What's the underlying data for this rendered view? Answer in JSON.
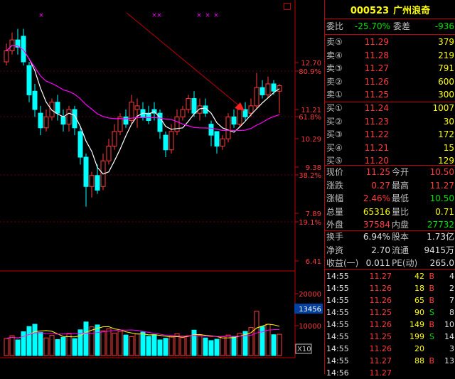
{
  "stock": {
    "code": "000523",
    "name": "广州浪奇"
  },
  "top_stats": [
    {
      "label": "委比",
      "value": "-25.70%",
      "label2": "委差",
      "value2": "-936"
    }
  ],
  "sell_orders": [
    {
      "label": "卖⑤",
      "price": "11.29",
      "volume": "379"
    },
    {
      "label": "卖④",
      "price": "11.28",
      "volume": "219"
    },
    {
      "label": "卖③",
      "price": "11.27",
      "volume": "791"
    },
    {
      "label": "卖②",
      "price": "11.26",
      "volume": "600"
    },
    {
      "label": "卖①",
      "price": "11.25",
      "volume": "300"
    }
  ],
  "buy_orders": [
    {
      "label": "买①",
      "price": "11.24",
      "volume": "1007"
    },
    {
      "label": "买②",
      "price": "11.23",
      "volume": "30"
    },
    {
      "label": "买③",
      "price": "11.22",
      "volume": "172"
    },
    {
      "label": "买④",
      "price": "11.21",
      "volume": "15"
    },
    {
      "label": "买⑤",
      "price": "11.20",
      "volume": "129"
    }
  ],
  "quote_rows": [
    {
      "l1": "现价",
      "v1": "11.25",
      "l2": "今开",
      "v2": "10.50"
    },
    {
      "l1": "涨跌",
      "v1": "0.27",
      "l2": "最高",
      "v2": "11.27"
    },
    {
      "l1": "涨幅",
      "v1": "2.46%",
      "l2": "最低",
      "v2": "10.50"
    },
    {
      "l1": "总量",
      "v1": "65316",
      "l2": "量比",
      "v2": "0.71"
    },
    {
      "l1": "外盘",
      "v1": "37584",
      "l2": "内盘",
      "v2": "27732"
    }
  ],
  "stat_rows": [
    {
      "l1": "换手",
      "v1": "6.94%",
      "l2": "股本",
      "v2": "1.73亿"
    },
    {
      "l1": "净资",
      "v1": "2.70",
      "l2": "流通",
      "v2": "9415万"
    },
    {
      "l1": "收益(一)",
      "v1": "0.011",
      "l2": "PE(动)",
      "v2": "265.0"
    }
  ],
  "trades": [
    {
      "time": "14:55",
      "price": "11.27",
      "volume": "42",
      "side": "B",
      "count": "4"
    },
    {
      "time": "14:55",
      "price": "11.26",
      "volume": "18",
      "side": "B",
      "count": "2"
    },
    {
      "time": "14:55",
      "price": "11.26",
      "volume": "65",
      "side": "B",
      "count": "7"
    },
    {
      "time": "14:55",
      "price": "11.25",
      "volume": "90",
      "side": "S",
      "count": "8"
    },
    {
      "time": "14:55",
      "price": "11.26",
      "volume": "149",
      "side": "B",
      "count": "10"
    },
    {
      "time": "14:55",
      "price": "11.25",
      "volume": "199",
      "side": "S",
      "count": "14"
    },
    {
      "time": "14:55",
      "price": "11.26",
      "volume": "20",
      "side": "",
      "count": "3"
    },
    {
      "time": "14:55",
      "price": "11.27",
      "volume": "88",
      "side": "B",
      "count": "13"
    },
    {
      "time": "14:56",
      "price": "11.27",
      "volume": "",
      "side": "",
      "count": ""
    }
  ],
  "price_axis": [
    {
      "label": "12.70"
    },
    {
      "label": "80.9%"
    },
    {
      "label": "11.21"
    },
    {
      "label": "61.8%"
    },
    {
      "label": "10.29"
    },
    {
      "label": "9.38"
    },
    {
      "label": "38.2%"
    },
    {
      "label": "7.89"
    },
    {
      "label": "19.1%"
    },
    {
      "label": "6.41"
    }
  ],
  "volume_axis": [
    {
      "label": "20000"
    },
    {
      "label": "13456"
    },
    {
      "label": "10000"
    },
    {
      "label": "X10"
    }
  ],
  "colors": {
    "up": "#ff3c3c",
    "down": "#00ffff",
    "ma_short": "#ffffff",
    "ma_long": "#ff00ff",
    "grid": "#c00000",
    "accent": "#ffff00"
  },
  "chart_data": {
    "type": "candlestick",
    "ma_lines": [
      "short MA (white)",
      "long MA (magenta)"
    ],
    "candles": [
      {
        "open": 11.9,
        "close": 12.2,
        "high": 12.4,
        "low": 11.8
      },
      {
        "open": 12.2,
        "close": 12.5,
        "high": 12.7,
        "low": 12.1
      },
      {
        "open": 12.5,
        "close": 12.3,
        "high": 12.8,
        "low": 12.1
      },
      {
        "open": 12.6,
        "close": 11.9,
        "high": 12.8,
        "low": 11.8
      },
      {
        "open": 11.8,
        "close": 11.0,
        "high": 11.9,
        "low": 10.8
      },
      {
        "open": 11.1,
        "close": 10.6,
        "high": 11.3,
        "low": 10.4
      },
      {
        "open": 10.5,
        "close": 10.1,
        "high": 10.7,
        "low": 9.9
      },
      {
        "open": 10.1,
        "close": 10.4,
        "high": 10.6,
        "low": 10.0
      },
      {
        "open": 10.4,
        "close": 10.8,
        "high": 10.9,
        "low": 10.3
      },
      {
        "open": 10.8,
        "close": 10.5,
        "high": 11.0,
        "low": 10.3
      },
      {
        "open": 10.4,
        "close": 10.2,
        "high": 10.6,
        "low": 10.0
      },
      {
        "open": 10.2,
        "close": 10.6,
        "high": 10.7,
        "low": 10.0
      },
      {
        "open": 10.6,
        "close": 10.1,
        "high": 10.7,
        "low": 9.9
      },
      {
        "open": 10.0,
        "close": 9.3,
        "high": 10.1,
        "low": 9.1
      },
      {
        "open": 9.3,
        "close": 8.5,
        "high": 9.4,
        "low": 7.95
      },
      {
        "open": 8.5,
        "close": 8.8,
        "high": 8.9,
        "low": 8.2
      },
      {
        "open": 8.8,
        "close": 8.4,
        "high": 9.1,
        "low": 8.3
      },
      {
        "open": 8.5,
        "close": 9.2,
        "high": 9.4,
        "low": 8.4
      },
      {
        "open": 9.2,
        "close": 9.6,
        "high": 9.8,
        "low": 9.1
      },
      {
        "open": 9.6,
        "close": 10.0,
        "high": 10.2,
        "low": 9.5
      },
      {
        "open": 10.0,
        "close": 10.4,
        "high": 10.5,
        "low": 9.9
      },
      {
        "open": 10.4,
        "close": 10.2,
        "high": 10.6,
        "low": 10.1
      },
      {
        "open": 10.3,
        "close": 10.8,
        "high": 11.0,
        "low": 10.2
      },
      {
        "open": 10.6,
        "close": 10.7,
        "high": 10.9,
        "low": 10.1
      },
      {
        "open": 10.6,
        "close": 10.4,
        "high": 10.8,
        "low": 10.3
      },
      {
        "open": 10.5,
        "close": 10.3,
        "high": 10.7,
        "low": 10.2
      },
      {
        "open": 10.6,
        "close": 10.5,
        "high": 10.8,
        "low": 10.3
      },
      {
        "open": 10.5,
        "close": 10.0,
        "high": 10.6,
        "low": 9.8
      },
      {
        "open": 9.9,
        "close": 9.5,
        "high": 10.0,
        "low": 9.3
      },
      {
        "open": 9.5,
        "close": 10.0,
        "high": 10.2,
        "low": 9.4
      },
      {
        "open": 10.0,
        "close": 10.4,
        "high": 10.6,
        "low": 9.9
      },
      {
        "open": 10.4,
        "close": 10.6,
        "high": 10.7,
        "low": 10.3
      },
      {
        "open": 10.6,
        "close": 10.9,
        "high": 11.0,
        "low": 10.5
      },
      {
        "open": 10.9,
        "close": 10.5,
        "high": 11.1,
        "low": 10.4
      },
      {
        "open": 10.5,
        "close": 10.7,
        "high": 10.9,
        "low": 10.3
      },
      {
        "open": 10.7,
        "close": 10.5,
        "high": 10.9,
        "low": 10.4
      },
      {
        "open": 10.2,
        "close": 9.9,
        "high": 10.3,
        "low": 9.6
      },
      {
        "open": 10.0,
        "close": 9.6,
        "high": 10.0,
        "low": 9.4
      },
      {
        "open": 9.6,
        "close": 9.8,
        "high": 9.9,
        "low": 9.5
      },
      {
        "open": 9.8,
        "close": 10.4,
        "high": 10.5,
        "low": 9.7
      },
      {
        "open": 10.4,
        "close": 10.2,
        "high": 10.6,
        "low": 10.1
      },
      {
        "open": 10.2,
        "close": 10.6,
        "high": 10.7,
        "low": 10.1
      },
      {
        "open": 10.6,
        "close": 10.4,
        "high": 10.8,
        "low": 10.3
      },
      {
        "open": 10.5,
        "close": 10.7,
        "high": 10.9,
        "low": 10.4
      },
      {
        "open": 10.7,
        "close": 11.2,
        "high": 11.6,
        "low": 10.6
      },
      {
        "open": 11.2,
        "close": 11.0,
        "high": 11.4,
        "low": 10.9
      },
      {
        "open": 11.0,
        "close": 11.3,
        "high": 11.5,
        "low": 10.9
      },
      {
        "open": 11.3,
        "close": 11.1,
        "high": 11.4,
        "low": 11.0
      },
      {
        "open": 11.1,
        "close": 11.25,
        "high": 11.3,
        "low": 10.5
      }
    ],
    "volumes": [
      5200,
      6100,
      4800,
      7300,
      8900,
      9600,
      7100,
      5400,
      6200,
      4900,
      5600,
      6800,
      5200,
      7900,
      10300,
      8800,
      9400,
      7600,
      8200,
      6900,
      7400,
      6300,
      5800,
      6600,
      7200,
      5900,
      6400,
      4800,
      5300,
      5900,
      6700,
      5500,
      6100,
      7800,
      6200,
      5400,
      4600,
      5000,
      5800,
      6300,
      5900,
      6800,
      7400,
      8600,
      13600,
      8900,
      9600,
      6400,
      6532
    ],
    "price_axis_range": [
      6.41,
      13.2
    ],
    "volume_axis_range": [
      0,
      24000
    ]
  }
}
